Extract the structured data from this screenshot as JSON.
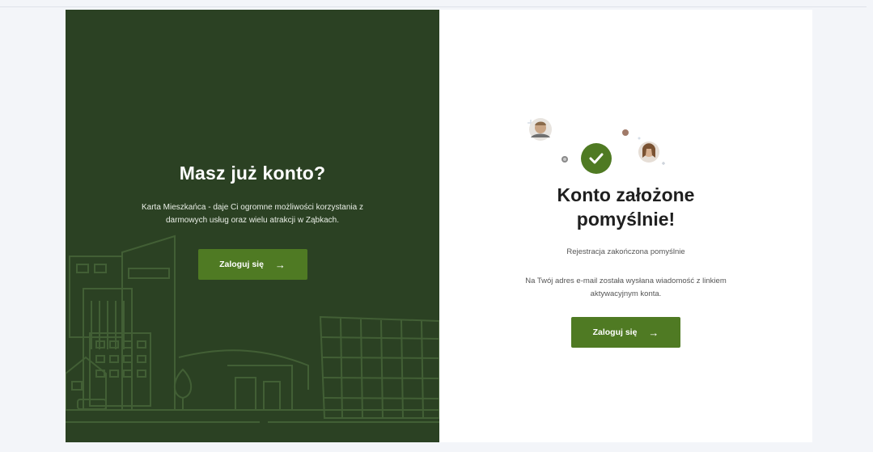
{
  "left_panel": {
    "title": "Masz już konto?",
    "description": "Karta Mieszkańca - daje Ci ogromne możliwości korzystania z darmowych usług oraz wielu atrakcji w Ząbkach.",
    "login_button": "Zaloguj się",
    "button_arrow": "→",
    "background_color": "#2b4123"
  },
  "right_panel": {
    "title": "Konto założone pomyślnie!",
    "subtitle": "Rejestracja zakończona pomyślnie",
    "message": "Na Twój adres e-mail została wysłana wiadomość z linkiem aktywacyjnym konta.",
    "login_button": "Zaloguj się",
    "button_arrow": "→",
    "check_icon": "check-icon"
  },
  "colors": {
    "accent": "#4f7a23",
    "dark_green": "#2b4123"
  }
}
